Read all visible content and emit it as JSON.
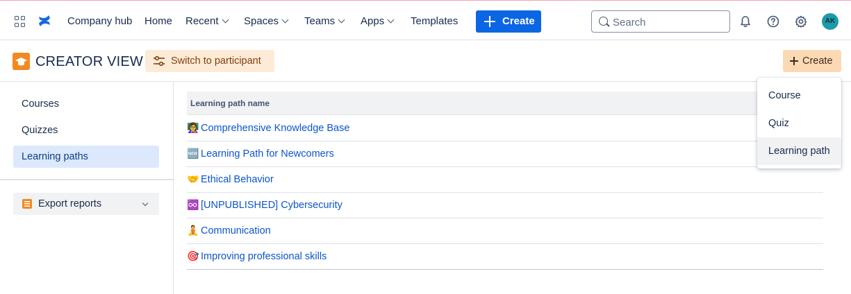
{
  "topnav": {
    "items": [
      {
        "label": "Company hub",
        "has_chevron": false
      },
      {
        "label": "Home",
        "has_chevron": false
      },
      {
        "label": "Recent",
        "has_chevron": true
      },
      {
        "label": "Spaces",
        "has_chevron": true
      },
      {
        "label": "Teams",
        "has_chevron": true
      },
      {
        "label": "Apps",
        "has_chevron": true
      },
      {
        "label": "Templates",
        "has_chevron": false
      }
    ],
    "create_label": "Create",
    "search_placeholder": "Search",
    "avatar_initials": "AK",
    "icons": [
      "app-switcher-icon",
      "confluence-logo-icon",
      "notification-bell-icon",
      "help-icon",
      "settings-gear-icon"
    ]
  },
  "header": {
    "title": "CREATOR VIEW",
    "switch_label": "Switch to participant",
    "create_label": "Create"
  },
  "sidebar": {
    "items": [
      {
        "label": "Courses",
        "active": false
      },
      {
        "label": "Quizzes",
        "active": false
      },
      {
        "label": "Learning paths",
        "active": true
      }
    ],
    "export_label": "Export reports"
  },
  "table": {
    "column_header": "Learning path name",
    "rows": [
      {
        "emoji": "👩‍🏫",
        "name": "Comprehensive Knowledge Base"
      },
      {
        "emoji": "🆕",
        "name": "Learning Path for Newcomers"
      },
      {
        "emoji": "🤝",
        "name": "Ethical Behavior"
      },
      {
        "emoji": "♾️",
        "name": "[UNPUBLISHED] Cybersecurity"
      },
      {
        "emoji": "🧘",
        "name": "Communication"
      },
      {
        "emoji": "🎯",
        "name": "Improving professional skills"
      }
    ]
  },
  "dropdown": {
    "items": [
      {
        "label": "Course",
        "hovered": false
      },
      {
        "label": "Quiz",
        "hovered": false
      },
      {
        "label": "Learning path",
        "hovered": true
      }
    ]
  },
  "colors": {
    "primary": "#0c66e4",
    "link": "#0c55cc",
    "accent_orange": "#f18a22",
    "active_bg": "#dce9fd"
  }
}
